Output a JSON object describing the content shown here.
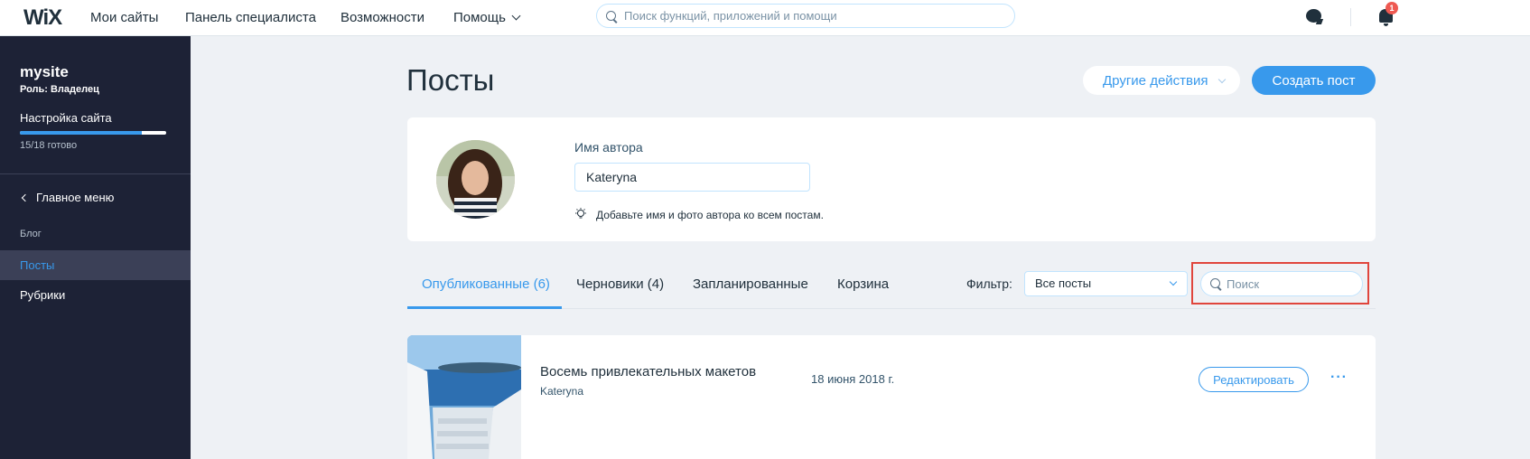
{
  "topbar": {
    "logo": "WiX",
    "nav": [
      "Мои сайты",
      "Панель специалиста",
      "Возможности",
      "Помощь"
    ],
    "search_placeholder": "Поиск функций, приложений и помощи",
    "notification_count": "1"
  },
  "sidebar": {
    "site_name": "mysite",
    "role": "Роль: Владелец",
    "setup_label": "Настройка сайта",
    "setup_progress": 0.833,
    "setup_progress_text": "15/18 готово",
    "main_menu": "Главное меню",
    "section": "Блог",
    "items": [
      {
        "label": "Посты",
        "active": true
      },
      {
        "label": "Рубрики",
        "active": false
      }
    ]
  },
  "main": {
    "title": "Посты",
    "more_actions": "Другие действия",
    "create_post": "Создать пост",
    "author": {
      "label": "Имя автора",
      "value": "Kateryna",
      "hint": "Добавьте имя и фото автора ко всем постам."
    },
    "tabs": [
      {
        "label": "Опубликованные (6)",
        "active": true
      },
      {
        "label": "Черновики (4)",
        "active": false
      },
      {
        "label": "Запланированные",
        "active": false
      },
      {
        "label": "Корзина",
        "active": false
      }
    ],
    "filter": {
      "label": "Фильтр:",
      "selected": "Все посты"
    },
    "search_placeholder": "Поиск",
    "posts": [
      {
        "title": "Восемь привлекательных макетов",
        "author": "Kateryna",
        "date": "18 июня 2018 г.",
        "edit_label": "Редактировать",
        "more": "···"
      }
    ]
  },
  "colors": {
    "accent": "#3899ec",
    "sidebar_bg": "#1d2236",
    "page_bg": "#eef1f5",
    "highlight": "#e0453c"
  }
}
